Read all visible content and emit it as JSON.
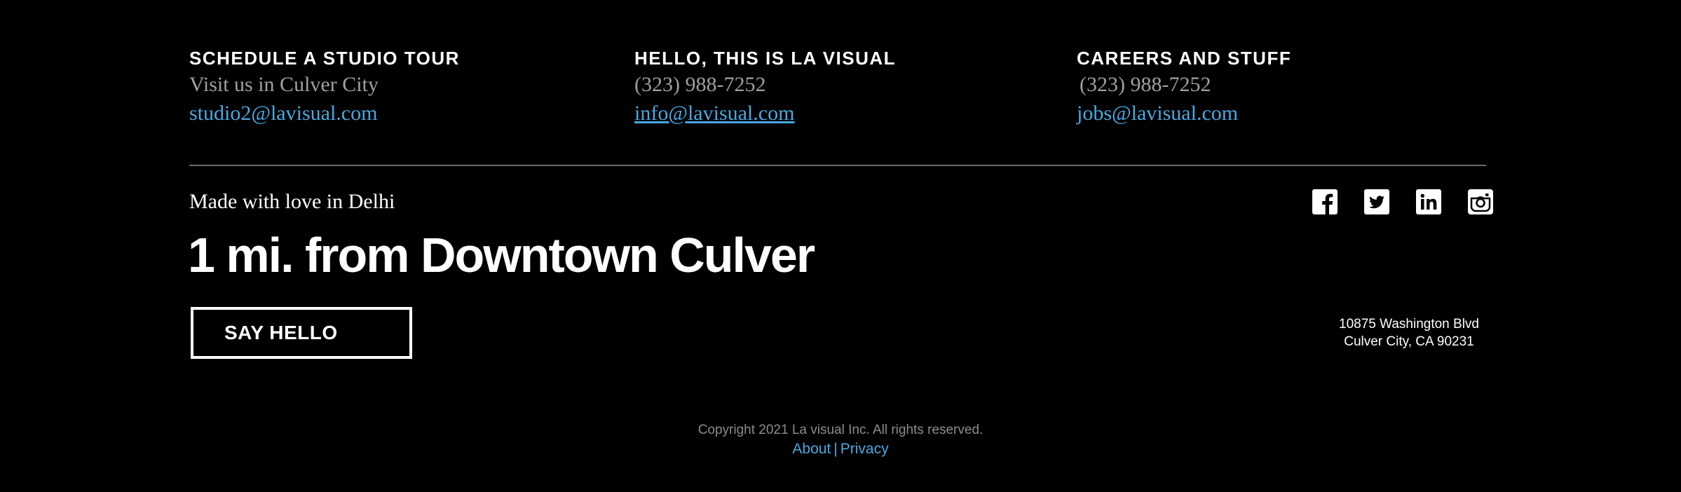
{
  "columns": [
    {
      "heading": "SCHEDULE A STUDIO TOUR",
      "line": "Visit us in Culver City",
      "email": "studio2@lavisual.com"
    },
    {
      "heading": "HELLO, THIS IS LA VISUAL",
      "line": "(323) 988-7252",
      "email": "info@lavisual.com"
    },
    {
      "heading": "CAREERS AND STUFF",
      "line": "(323) 988-7252",
      "email": "jobs@lavisual.com"
    }
  ],
  "tagline": "Made with love in Delhi",
  "headline": "1 mi. from Downtown Culver",
  "cta_label": "SAY HELLO",
  "social": {
    "icons": [
      "facebook-icon",
      "twitter-icon",
      "linkedin-icon",
      "instagram-icon"
    ]
  },
  "address": {
    "line1": "10875 Washington Blvd",
    "line2": "Culver City, CA 90231"
  },
  "copyright": "Copyright 2021 La visual Inc. All rights reserved.",
  "legal": {
    "about": "About",
    "separator": "|",
    "privacy": "Privacy"
  },
  "colors": {
    "background": "#000000",
    "accent_link": "#4aa8e0",
    "muted_text": "#a0a0a0",
    "divider": "#6a6a6a"
  }
}
